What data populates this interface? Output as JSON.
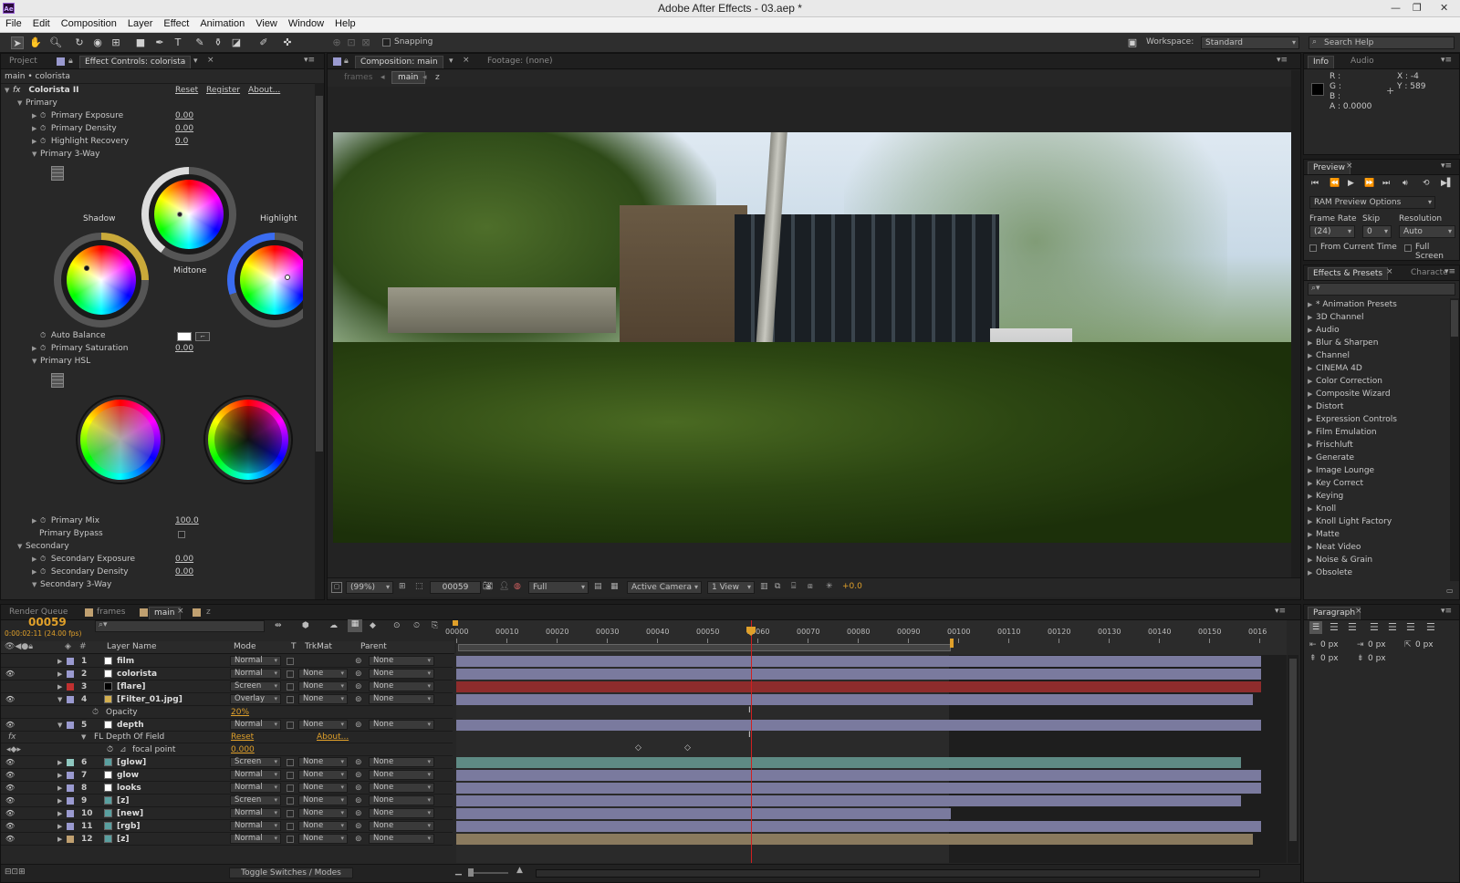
{
  "window": {
    "title": "Adobe After Effects - 03.aep *",
    "logo": "Ae"
  },
  "menu": [
    "File",
    "Edit",
    "Composition",
    "Layer",
    "Effect",
    "Animation",
    "View",
    "Window",
    "Help"
  ],
  "toolbar": {
    "snapping": "Snapping",
    "workspace_label": "Workspace:",
    "workspace_value": "Standard",
    "search_placeholder": "Search Help"
  },
  "effect_controls": {
    "tab_project": "Project",
    "tab_effect": "Effect Controls: colorista",
    "breadcrumb": "main • colorista",
    "effect_name": "Colorista II",
    "reset": "Reset",
    "register": "Register",
    "about": "About...",
    "primary": "Primary",
    "primary_exposure": "Primary Exposure",
    "primary_exposure_val": "0.00",
    "primary_density": "Primary Density",
    "primary_density_val": "0.00",
    "highlight_recovery": "Highlight Recovery",
    "highlight_recovery_val": "0.0",
    "primary_3way": "Primary 3-Way",
    "shadow": "Shadow",
    "midtone": "Midtone",
    "highlight": "Highlight",
    "auto_balance": "Auto Balance",
    "primary_saturation": "Primary Saturation",
    "primary_saturation_val": "0.00",
    "primary_hsl": "Primary HSL",
    "primary_mix": "Primary Mix",
    "primary_mix_val": "100.0",
    "primary_bypass": "Primary Bypass",
    "secondary": "Secondary",
    "secondary_exposure": "Secondary Exposure",
    "secondary_exposure_val": "0.00",
    "secondary_density": "Secondary Density",
    "secondary_density_val": "0.00",
    "secondary_3way": "Secondary 3-Way"
  },
  "composition": {
    "tab_comp": "Composition: main",
    "tab_footage": "Footage: (none)",
    "crumb_frames": "frames",
    "crumb_main": "main",
    "crumb_z": "z",
    "zoom": "(99%)",
    "frame": "00059",
    "quality": "Full",
    "camera": "Active Camera",
    "views": "1 View",
    "exposure": "+0.0"
  },
  "info": {
    "tab_info": "Info",
    "tab_audio": "Audio",
    "r": "R :",
    "g": "G :",
    "b": "B :",
    "a": "A :  0.0000",
    "x": "X : -4",
    "y": "Y : 589"
  },
  "preview": {
    "tab": "Preview",
    "ram": "RAM Preview Options",
    "frame_rate": "Frame Rate",
    "skip": "Skip",
    "resolution": "Resolution",
    "frame_rate_val": "(24)",
    "skip_val": "0",
    "resolution_val": "Auto",
    "from_current": "From Current Time",
    "full_screen": "Full Screen"
  },
  "effects_presets": {
    "tab": "Effects & Presets",
    "tab2": "Characte",
    "items": [
      "* Animation Presets",
      "3D Channel",
      "Audio",
      "Blur & Sharpen",
      "Channel",
      "CINEMA 4D",
      "Color Correction",
      "Composite Wizard",
      "Distort",
      "Expression Controls",
      "Film Emulation",
      "Frischluft",
      "Generate",
      "Image Lounge",
      "Key Correct",
      "Keying",
      "Knoll",
      "Knoll Light Factory",
      "Matte",
      "Neat Video",
      "Noise & Grain",
      "Obsolete"
    ]
  },
  "timeline": {
    "tabs": [
      "Render Queue",
      "frames",
      "main",
      "z"
    ],
    "timecode": "00059",
    "subtime": "0:00:02:11 (24.00 fps)",
    "headers": {
      "name": "Layer Name",
      "mode": "Mode",
      "t": "T",
      "trkmat": "TrkMat",
      "parent": "Parent"
    },
    "ruler": [
      "00000",
      "00010",
      "00020",
      "00030",
      "00040",
      "00050",
      "00060",
      "00070",
      "00080",
      "00090",
      "00100",
      "00110",
      "00120",
      "00130",
      "00140",
      "00150",
      "0016"
    ],
    "layers": [
      {
        "num": "1",
        "name": "film",
        "mode": "Normal",
        "trk": "",
        "parent": "None",
        "color": "#9a9ad0",
        "sw": "#ffffff",
        "bar": "#7a7a9e",
        "end": 1.0
      },
      {
        "num": "2",
        "name": "colorista",
        "mode": "Normal",
        "trk": "None",
        "parent": "None",
        "color": "#9a9ad0",
        "sw": "#ffffff",
        "bar": "#7a7a9e",
        "end": 1.0
      },
      {
        "num": "3",
        "name": "[flare]",
        "mode": "Screen",
        "trk": "None",
        "parent": "None",
        "color": "#c03030",
        "sw": "#000000",
        "bar": "#8e2c2c",
        "end": 1.0
      },
      {
        "num": "4",
        "name": "[Filter_01.jpg]",
        "mode": "Overlay",
        "trk": "None",
        "parent": "None",
        "color": "#9a9ad0",
        "sw": "#d4b050",
        "bar": "#7a7a9e",
        "end": 0.99
      },
      {
        "num": "5",
        "name": "depth",
        "mode": "Normal",
        "trk": "None",
        "parent": "None",
        "color": "#9a9ad0",
        "sw": "#ffffff",
        "bar": "#7a7a9e",
        "end": 1.0
      },
      {
        "num": "6",
        "name": "[glow]",
        "mode": "Screen",
        "trk": "None",
        "parent": "None",
        "color": "#8fc8c0",
        "sw": "#5aa0a0",
        "bar": "#5e8a84",
        "end": 0.975
      },
      {
        "num": "7",
        "name": "glow",
        "mode": "Normal",
        "trk": "None",
        "parent": "None",
        "color": "#9a9ad0",
        "sw": "#ffffff",
        "bar": "#7a7a9e",
        "end": 1.0
      },
      {
        "num": "8",
        "name": "looks",
        "mode": "Normal",
        "trk": "None",
        "parent": "None",
        "color": "#9a9ad0",
        "sw": "#ffffff",
        "bar": "#7a7a9e",
        "end": 1.0
      },
      {
        "num": "9",
        "name": "[z]",
        "mode": "Screen",
        "trk": "None",
        "parent": "None",
        "color": "#9a9ad0",
        "sw": "#5aa0a0",
        "bar": "#7a7a9e",
        "end": 0.975
      },
      {
        "num": "10",
        "name": "[new]",
        "mode": "Normal",
        "trk": "None",
        "parent": "None",
        "color": "#9a9ad0",
        "sw": "#5aa0a0",
        "bar": "#7a7a9e",
        "end": 0.615
      },
      {
        "num": "11",
        "name": "[rgb]",
        "mode": "Normal",
        "trk": "None",
        "parent": "None",
        "color": "#9a9ad0",
        "sw": "#5aa0a0",
        "bar": "#7a7a9e",
        "end": 1.0
      },
      {
        "num": "12",
        "name": "[z]",
        "mode": "Normal",
        "trk": "None",
        "parent": "None",
        "color": "#c0a070",
        "sw": "#5aa0a0",
        "bar": "#8a7a5e",
        "end": 0.99
      }
    ],
    "opacity_label": "Opacity",
    "opacity_val": "20%",
    "fl_dof": "FL Depth Of Field",
    "fl_reset": "Reset",
    "fl_about": "About...",
    "focal_point": "focal point",
    "focal_val": "0.000",
    "toggle": "Toggle Switches / Modes"
  },
  "paragraph": {
    "tab": "Paragraph",
    "px1": "0 px",
    "px2": "0 px",
    "px3": "0 px",
    "px4": "0 px",
    "px5": "0 px"
  }
}
